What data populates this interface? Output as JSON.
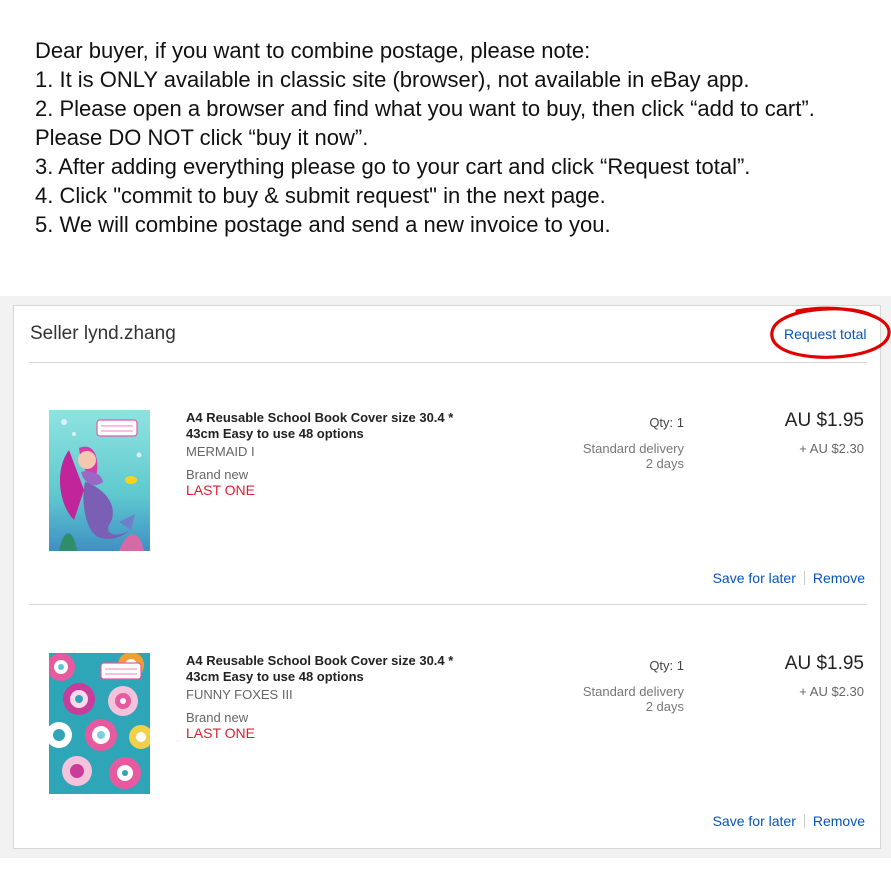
{
  "notice": {
    "intro": "Dear buyer, if you want to combine postage, please note:",
    "steps": [
      "1.  It is ONLY available in classic site (browser), not available in eBay app.",
      "2.  Please open a browser and find what you want to buy, then click “add to cart”. Please DO NOT click “buy it now”.",
      "3.  After adding everything please go to your cart and click “Request total”.",
      "4.  Click \"commit to buy & submit request\" in the next page.",
      "5.  We will combine postage and send a new invoice to you."
    ]
  },
  "cart": {
    "seller_label": "Seller lynd.zhang",
    "request_total": "Request total",
    "annotation_color": "#e00000",
    "items": [
      {
        "title": "A4 Reusable School Book Cover size 30.4 * 43cm Easy to use 48 options",
        "variant": "MERMAID I",
        "condition": "Brand new",
        "stock": "LAST ONE",
        "qty": "Qty: 1",
        "delivery": "Standard delivery",
        "delivery_time": "2 days",
        "price": "AU $1.95",
        "postage": "+ AU $2.30",
        "save_for_later": "Save for later",
        "remove": "Remove",
        "image": "mermaid-book-cover"
      },
      {
        "title": "A4 Reusable School Book Cover size 30.4 * 43cm Easy to use 48 options",
        "variant": "FUNNY FOXES III",
        "condition": "Brand new",
        "stock": "LAST ONE",
        "qty": "Qty: 1",
        "delivery": "Standard delivery",
        "delivery_time": "2 days",
        "price": "AU $1.95",
        "postage": "+ AU $2.30",
        "save_for_later": "Save for later",
        "remove": "Remove",
        "image": "funny-foxes-book-cover"
      }
    ]
  }
}
